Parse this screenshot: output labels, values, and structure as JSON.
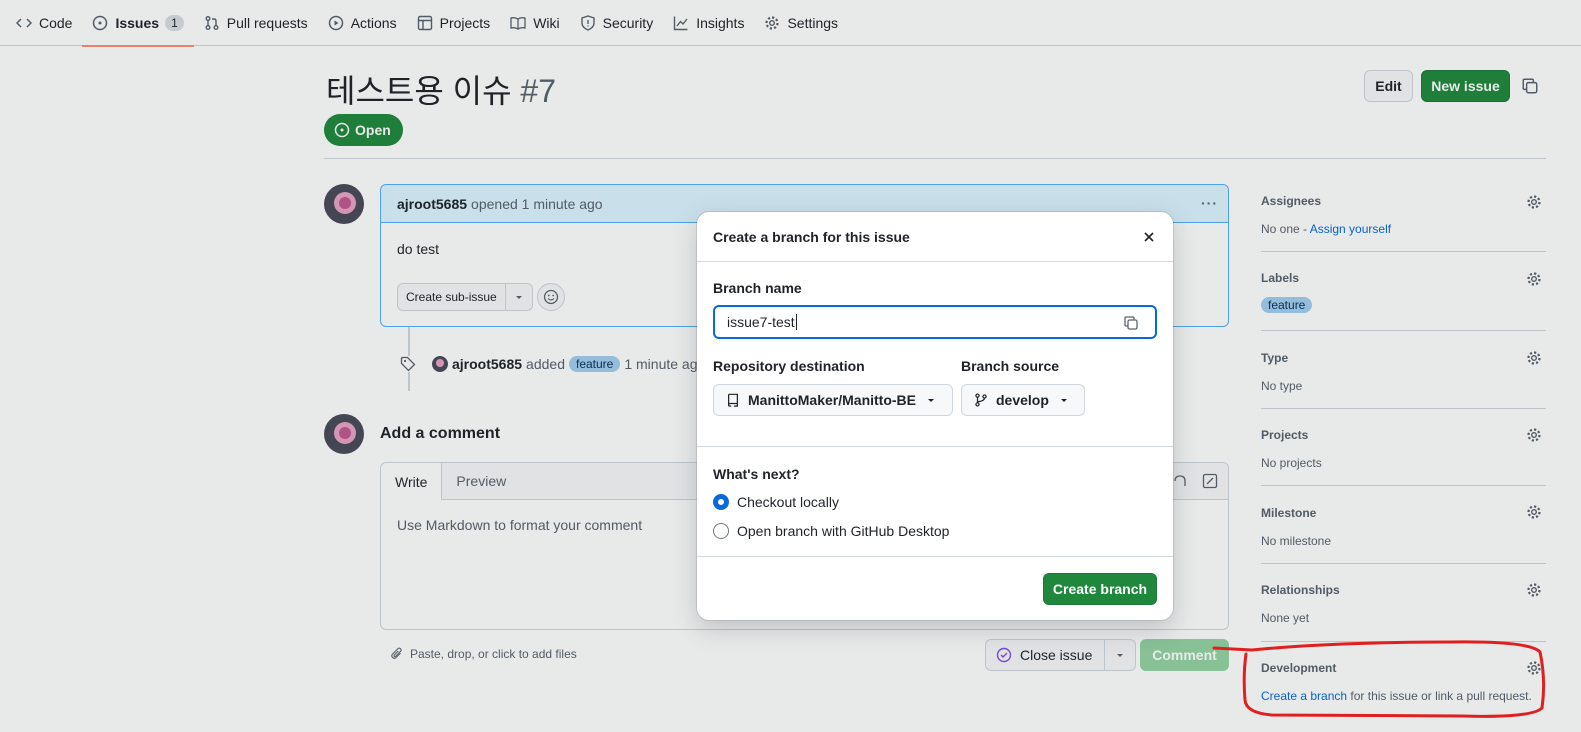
{
  "nav": {
    "tabs": [
      {
        "label": "Code"
      },
      {
        "label": "Issues",
        "count": "1"
      },
      {
        "label": "Pull requests"
      },
      {
        "label": "Actions"
      },
      {
        "label": "Projects"
      },
      {
        "label": "Wiki"
      },
      {
        "label": "Security"
      },
      {
        "label": "Insights"
      },
      {
        "label": "Settings"
      }
    ]
  },
  "issue": {
    "title": "테스트용 이슈",
    "number": "#7",
    "state": "Open",
    "edit_label": "Edit",
    "new_issue_label": "New issue"
  },
  "comment": {
    "author": "ajroot5685",
    "meta": "opened 1 minute ago",
    "body": "do test",
    "create_subissue_label": "Create sub-issue"
  },
  "timeline": {
    "author": "ajroot5685",
    "action": "added",
    "label": "feature",
    "time": "1 minute ago"
  },
  "composer": {
    "title": "Add a comment",
    "write_tab": "Write",
    "preview_tab": "Preview",
    "placeholder": "Use Markdown to format your comment",
    "attach_hint": "Paste, drop, or click to add files",
    "close_issue_label": "Close issue",
    "comment_label": "Comment"
  },
  "sidebar": {
    "assignees": {
      "title": "Assignees",
      "value": "No one - ",
      "link": "Assign yourself"
    },
    "labels": {
      "title": "Labels",
      "label": "feature"
    },
    "type": {
      "title": "Type",
      "value": "No type"
    },
    "projects": {
      "title": "Projects",
      "value": "No projects"
    },
    "milestone": {
      "title": "Milestone",
      "value": "No milestone"
    },
    "relationships": {
      "title": "Relationships",
      "value": "None yet"
    },
    "development": {
      "title": "Development",
      "link": "Create a branch",
      "value": " for this issue or link a pull request."
    }
  },
  "dialog": {
    "title": "Create a branch for this issue",
    "branch_name_label": "Branch name",
    "branch_name_value": "issue7-test",
    "repo_dest_label": "Repository destination",
    "repo_dest_value": "ManittoMaker/Manitto-BE",
    "branch_source_label": "Branch source",
    "branch_source_value": "develop",
    "whats_next_label": "What's next?",
    "options": [
      {
        "label": "Checkout locally",
        "checked": true
      },
      {
        "label": "Open branch with GitHub Desktop",
        "checked": false
      }
    ],
    "create_label": "Create branch"
  },
  "colors": {
    "accent": "#0969da",
    "primary_button": "#1f883d",
    "annotation": "#e02020"
  }
}
